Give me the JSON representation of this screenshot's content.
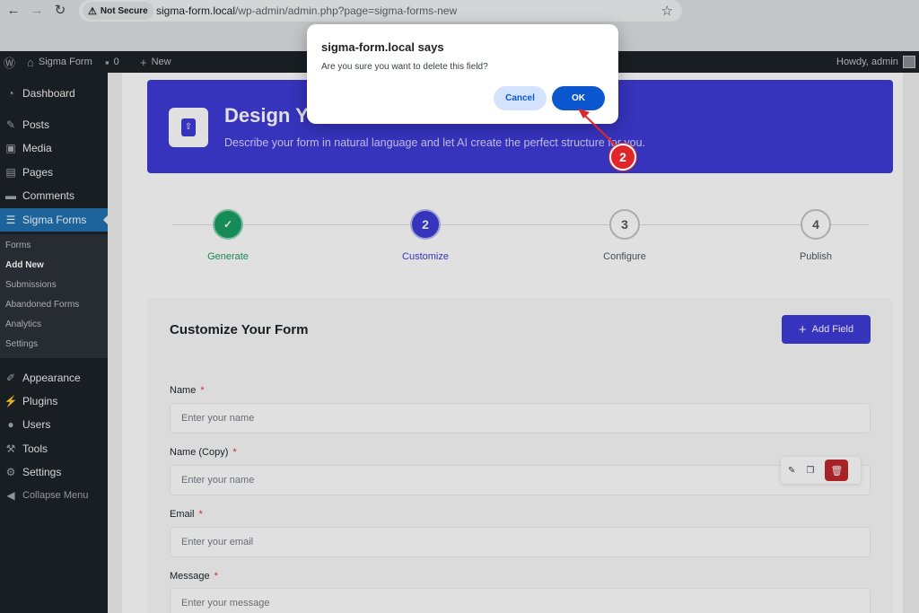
{
  "browser": {
    "security_label": "Not Secure",
    "url_domain": "sigma-form.local",
    "url_path": "/wp-admin/admin.php?page=sigma-forms-new"
  },
  "adminbar": {
    "site_name": "Sigma Form",
    "comments_count": "0",
    "new_label": "New",
    "howdy": "Howdy, admin"
  },
  "sidebar": {
    "items": [
      {
        "label": "Dashboard",
        "icon": "dashboard-icon"
      },
      {
        "label": "Posts",
        "icon": "pin-icon"
      },
      {
        "label": "Media",
        "icon": "media-icon"
      },
      {
        "label": "Pages",
        "icon": "pages-icon"
      },
      {
        "label": "Comments",
        "icon": "comments-icon"
      },
      {
        "label": "Sigma Forms",
        "icon": "forms-icon"
      }
    ],
    "submenu": [
      "Forms",
      "Add New",
      "Submissions",
      "Abandoned Forms",
      "Analytics",
      "Settings"
    ],
    "lower_items": [
      {
        "label": "Appearance",
        "icon": "brush-icon"
      },
      {
        "label": "Plugins",
        "icon": "plugin-icon"
      },
      {
        "label": "Users",
        "icon": "users-icon"
      },
      {
        "label": "Tools",
        "icon": "wrench-icon"
      },
      {
        "label": "Settings",
        "icon": "settings-icon"
      }
    ],
    "collapse_label": "Collapse Menu"
  },
  "hero": {
    "title": "Design Y",
    "subtitle": "Describe your form in natural language and let AI create the perfect structure for you."
  },
  "steps": [
    {
      "number": "✓",
      "label": "Generate",
      "state": "done"
    },
    {
      "number": "2",
      "label": "Customize",
      "state": "active"
    },
    {
      "number": "3",
      "label": "Configure",
      "state": "pending"
    },
    {
      "number": "4",
      "label": "Publish",
      "state": "pending"
    }
  ],
  "customize": {
    "title": "Customize Your Form",
    "add_field_label": "Add Field",
    "fields": [
      {
        "label": "Name",
        "placeholder": "Enter your name"
      },
      {
        "label": "Name (Copy)",
        "placeholder": "Enter your name"
      },
      {
        "label": "Email",
        "placeholder": "Enter your email"
      },
      {
        "label": "Message",
        "placeholder": "Enter your message"
      }
    ],
    "required_mark": "*"
  },
  "dialog": {
    "title": "sigma-form.local says",
    "message": "Are you sure you want to delete this field?",
    "cancel_label": "Cancel",
    "ok_label": "OK"
  },
  "annotation": {
    "step_number": "2"
  },
  "colors": {
    "brand": "#3e3bd6",
    "wp_blue": "#2271b1",
    "ok_button": "#0b57d0",
    "delete_red": "#c0282c",
    "generate_green": "#1a9e63"
  }
}
